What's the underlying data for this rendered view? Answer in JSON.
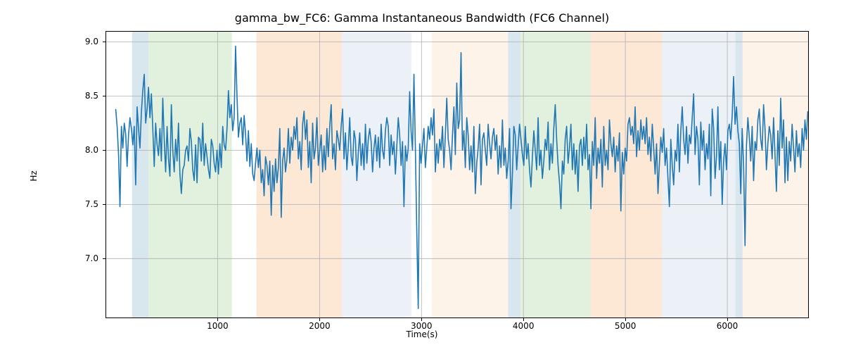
{
  "chart_data": {
    "type": "line",
    "title": "gamma_bw_FC6: Gamma Instantaneous Bandwidth (FC6 Channel)",
    "xlabel": "Time(s)",
    "ylabel": "Hz",
    "xlim": [
      -100,
      6800
    ],
    "ylim": [
      6.45,
      9.1
    ],
    "xticks": [
      1000,
      2000,
      3000,
      4000,
      5000,
      6000
    ],
    "yticks": [
      7.0,
      7.5,
      8.0,
      8.5,
      9.0
    ],
    "grid": true,
    "regions": [
      {
        "x0": 160,
        "x1": 320,
        "color": "#8fb6cf"
      },
      {
        "x0": 320,
        "x1": 1140,
        "color": "#a8d6a0"
      },
      {
        "x0": 1380,
        "x1": 2220,
        "color": "#f6bd85"
      },
      {
        "x0": 2220,
        "x1": 2900,
        "color": "#c9d8ea"
      },
      {
        "x0": 3100,
        "x1": 3850,
        "color": "#f9ddc0"
      },
      {
        "x0": 3850,
        "x1": 3970,
        "color": "#8fb6cf"
      },
      {
        "x0": 3970,
        "x1": 4660,
        "color": "#a8d6a0"
      },
      {
        "x0": 4660,
        "x1": 5360,
        "color": "#f6bd85"
      },
      {
        "x0": 5360,
        "x1": 6080,
        "color": "#c9d8ea"
      },
      {
        "x0": 6080,
        "x1": 6150,
        "color": "#8fb6cf"
      },
      {
        "x0": 6150,
        "x1": 6800,
        "color": "#f9ddc0"
      }
    ],
    "series": [
      {
        "name": "gamma_bw_FC6",
        "color": "#1f77b4",
        "x_start": 0,
        "x_step": 14,
        "y": [
          8.38,
          8.22,
          7.96,
          7.48,
          8.22,
          8.02,
          8.25,
          8.15,
          7.85,
          8.14,
          8.3,
          8.2,
          8.05,
          8.22,
          7.68,
          8.4,
          8.2,
          8.02,
          8.35,
          8.55,
          8.7,
          8.25,
          8.38,
          8.58,
          8.3,
          8.52,
          8.2,
          7.85,
          8.25,
          8.05,
          7.95,
          8.2,
          7.9,
          8.48,
          8.1,
          7.8,
          8.22,
          7.92,
          7.76,
          8.42,
          8.0,
          7.8,
          8.1,
          7.9,
          8.25,
          7.78,
          7.6,
          7.82,
          7.86,
          8.0,
          8.04,
          7.9,
          8.2,
          8.08,
          7.82,
          7.72,
          8.05,
          7.7,
          8.12,
          8.1,
          7.9,
          8.25,
          7.86,
          8.06,
          7.94,
          7.82,
          7.74,
          8.1,
          8.04,
          7.88,
          7.8,
          8.0,
          7.78,
          8.06,
          7.84,
          8.22,
          8.05,
          8.0,
          8.2,
          8.55,
          8.3,
          8.42,
          8.18,
          8.3,
          8.96,
          8.5,
          8.12,
          8.25,
          8.3,
          8.05,
          8.32,
          8.15,
          7.9,
          8.18,
          7.85,
          8.06,
          7.78,
          7.72,
          7.88,
          8.02,
          7.84,
          8.0,
          7.7,
          7.82,
          7.58,
          7.94,
          7.86,
          7.68,
          7.9,
          7.4,
          7.86,
          7.62,
          7.92,
          7.7,
          7.84,
          8.2,
          7.38,
          7.9,
          8.02,
          7.8,
          7.92,
          8.2,
          7.88,
          8.12,
          8.0,
          8.22,
          8.1,
          8.3,
          7.92,
          8.08,
          7.82,
          8.24,
          8.36,
          8.1,
          8.28,
          7.84,
          8.08,
          7.7,
          8.25,
          7.92,
          8.02,
          8.3,
          7.86,
          8.0,
          8.14,
          7.8,
          8.04,
          7.82,
          8.2,
          7.94,
          8.22,
          8.42,
          7.92,
          8.06,
          7.82,
          8.18,
          8.1,
          8.0,
          8.22,
          8.38,
          7.92,
          8.16,
          7.82,
          8.04,
          8.3,
          7.94,
          7.86,
          8.18,
          8.1,
          7.72,
          7.98,
          8.16,
          7.86,
          8.06,
          7.82,
          8.24,
          7.88,
          8.1,
          8.2,
          8.08,
          7.8,
          8.02,
          8.14,
          7.9,
          8.12,
          7.84,
          8.24,
          8.0,
          7.92,
          8.18,
          8.3,
          8.22,
          7.86,
          8.14,
          7.96,
          8.08,
          7.78,
          8.04,
          8.3,
          8.14,
          7.86,
          8.08,
          7.48,
          8.04,
          7.9,
          8.02,
          8.54,
          8.18,
          8.0,
          8.7,
          8.02,
          7.24,
          6.54,
          8.06,
          7.88,
          8.04,
          8.2,
          7.84,
          8.02,
          8.22,
          8.1,
          8.3,
          8.14,
          8.38,
          7.8,
          8.06,
          7.88,
          8.1,
          8.0,
          8.22,
          7.84,
          8.14,
          8.48,
          8.1,
          8.0,
          7.82,
          8.14,
          8.4,
          7.96,
          8.62,
          8.2,
          8.28,
          8.9,
          8.0,
          8.18,
          7.84,
          8.3,
          8.14,
          7.82,
          8.04,
          7.8,
          8.22,
          7.6,
          7.88,
          8.02,
          8.24,
          7.68,
          8.1,
          8.16,
          8.0,
          7.86,
          8.24,
          8.06,
          7.92,
          8.12,
          8.2,
          8.0,
          8.14,
          7.78,
          8.04,
          7.84,
          8.28,
          7.86,
          8.02,
          7.74,
          7.9,
          8.2,
          7.46,
          7.78,
          8.22,
          8.14,
          7.82,
          8.04,
          8.24,
          8.1,
          7.96,
          7.86,
          8.22,
          7.92,
          8.06,
          7.82,
          7.66,
          7.94,
          8.18,
          8.0,
          7.82,
          8.3,
          7.86,
          8.0,
          7.74,
          7.9,
          8.1,
          8.0,
          8.26,
          7.82,
          8.06,
          7.88,
          8.2,
          8.42,
          8.1,
          7.86,
          7.7,
          7.46,
          7.9,
          7.78,
          8.1,
          8.22,
          7.88,
          8.02,
          8.24,
          7.82,
          8.06,
          7.78,
          8.0,
          7.62,
          8.04,
          8.1,
          7.86,
          8.12,
          7.92,
          8.24,
          7.82,
          7.96,
          7.46,
          8.08,
          7.86,
          8.3,
          7.74,
          8.02,
          7.88,
          8.1,
          7.66,
          8.22,
          7.86,
          8.0,
          7.82,
          8.28,
          8.06,
          7.94,
          8.12,
          7.8,
          8.04,
          7.9,
          8.16,
          7.44,
          7.98,
          7.78,
          8.02,
          7.9,
          8.24,
          8.3,
          8.14,
          8.22,
          8.06,
          8.4,
          7.94,
          8.18,
          8.0,
          8.28,
          8.1,
          8.22,
          8.06,
          8.3,
          7.96,
          8.12,
          7.9,
          8.24,
          8.02,
          7.78,
          8.06,
          7.6,
          7.88,
          8.12,
          7.98,
          8.2,
          7.86,
          8.02,
          7.74,
          7.48,
          8.1,
          7.86,
          7.68,
          8.0,
          7.9,
          8.24,
          7.8,
          8.18,
          8.4,
          8.1,
          7.96,
          8.22,
          7.88,
          8.14,
          8.06,
          8.3,
          8.52,
          7.96,
          8.22,
          8.1,
          7.68,
          8.26,
          8.0,
          8.18,
          7.82,
          8.06,
          7.92,
          8.24,
          7.58,
          8.38,
          8.2,
          7.74,
          7.94,
          8.4,
          7.82,
          8.08,
          7.5,
          7.9,
          8.06,
          7.82,
          8.18,
          8.24,
          8.1,
          8.32,
          8.68,
          8.24,
          8.4,
          8.18,
          8.06,
          7.6,
          8.2,
          7.86,
          7.12,
          8.04,
          8.3,
          8.12,
          7.9,
          8.22,
          7.72,
          8.08,
          8.0,
          8.28,
          8.38,
          8.1,
          8.0,
          8.42,
          8.2,
          7.82,
          8.06,
          8.22,
          8.14,
          7.92,
          8.3,
          7.96,
          7.62,
          8.18,
          7.86,
          8.48,
          8.02,
          8.28,
          7.7,
          8.12,
          7.72,
          8.08,
          7.9,
          8.24,
          8.02,
          7.8,
          8.18,
          7.94,
          8.06,
          7.84,
          8.2,
          8.0,
          8.28,
          8.1,
          8.36
        ]
      }
    ]
  }
}
